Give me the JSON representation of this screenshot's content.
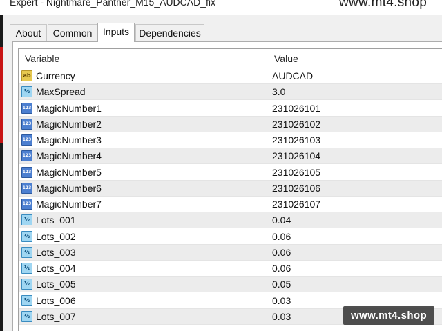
{
  "window": {
    "title": "Expert - Nightmare_Panther_M15_AUDCAD_fix"
  },
  "watermark": {
    "top": "www.mt4.shop",
    "bottom": "www.mt4.shop"
  },
  "tabs": [
    {
      "label": "About"
    },
    {
      "label": "Common"
    },
    {
      "label": "Inputs",
      "active": true
    },
    {
      "label": "Dependencies"
    }
  ],
  "table": {
    "headers": {
      "variable": "Variable",
      "value": "Value"
    },
    "rows": [
      {
        "icon": "string-type-icon",
        "icon_text": "ab",
        "name": "Currency",
        "value": "AUDCAD"
      },
      {
        "icon": "double-type-icon",
        "icon_text": "½",
        "name": "MaxSpread",
        "value": "3.0"
      },
      {
        "icon": "integer-type-icon",
        "icon_text": "123",
        "name": "MagicNumber1",
        "value": "231026101"
      },
      {
        "icon": "integer-type-icon",
        "icon_text": "123",
        "name": "MagicNumber2",
        "value": "231026102"
      },
      {
        "icon": "integer-type-icon",
        "icon_text": "123",
        "name": "MagicNumber3",
        "value": "231026103"
      },
      {
        "icon": "integer-type-icon",
        "icon_text": "123",
        "name": "MagicNumber4",
        "value": "231026104"
      },
      {
        "icon": "integer-type-icon",
        "icon_text": "123",
        "name": "MagicNumber5",
        "value": "231026105"
      },
      {
        "icon": "integer-type-icon",
        "icon_text": "123",
        "name": "MagicNumber6",
        "value": "231026106"
      },
      {
        "icon": "integer-type-icon",
        "icon_text": "123",
        "name": "MagicNumber7",
        "value": "231026107"
      },
      {
        "icon": "double-type-icon",
        "icon_text": "½",
        "name": "Lots_001",
        "value": "0.04"
      },
      {
        "icon": "double-type-icon",
        "icon_text": "½",
        "name": "Lots_002",
        "value": "0.06"
      },
      {
        "icon": "double-type-icon",
        "icon_text": "½",
        "name": "Lots_003",
        "value": "0.06"
      },
      {
        "icon": "double-type-icon",
        "icon_text": "½",
        "name": "Lots_004",
        "value": "0.06"
      },
      {
        "icon": "double-type-icon",
        "icon_text": "½",
        "name": "Lots_005",
        "value": "0.05"
      },
      {
        "icon": "double-type-icon",
        "icon_text": "½",
        "name": "Lots_006",
        "value": "0.03"
      },
      {
        "icon": "double-type-icon",
        "icon_text": "½",
        "name": "Lots_007",
        "value": "0.03"
      }
    ]
  }
}
